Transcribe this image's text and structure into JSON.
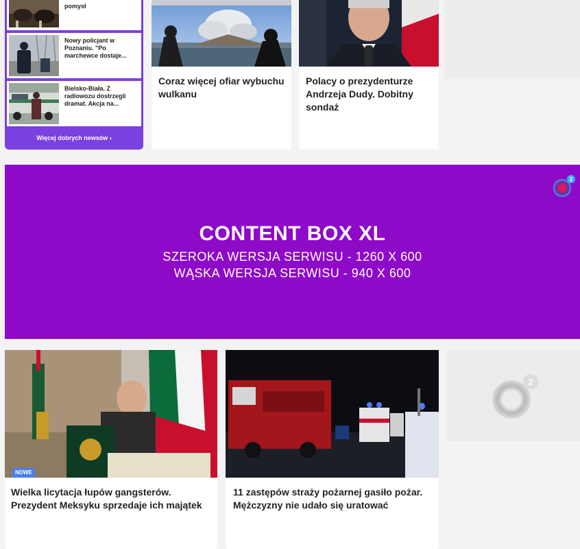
{
  "good_news": {
    "items": [
      {
        "text": "pomysł"
      },
      {
        "text": "Nowy policjant w Poznaniu. \"Po marchewce dostaje..."
      },
      {
        "text": "Bielsko-Biała. Z radiowozu dostrzegli dramat. Akcja na..."
      }
    ],
    "more_label": "Więcej dobrych newsów ›",
    "accent": "#7b40e0"
  },
  "top_cards": [
    {
      "title": "Coraz więcej ofiar wybuchu wulkanu"
    },
    {
      "title": "Polacy o prezydenturze Andrzeja Dudy. Dobitny sondaż"
    }
  ],
  "banner": {
    "title": "CONTENT BOX XL",
    "line1": "SZEROKA WERSJA SERWISU - 1260 X 600",
    "line2": "WĄSKA WERSJA SERWISU - 940 X 600",
    "logo_icon": "o2-logo-icon",
    "logo_sup": "2",
    "color": "#8e0ac9"
  },
  "bottom_cards": [
    {
      "title": "Wielka licytacja łupów gangsterów. Prezydent Meksyku sprzedaje ich majątek",
      "badge": "NOWE"
    },
    {
      "title": "11 zastępów straży pożarnej gasiło pożar. Mężczyzny nie udało się uratować"
    }
  ],
  "placeholder": {
    "logo_sup": "2"
  }
}
